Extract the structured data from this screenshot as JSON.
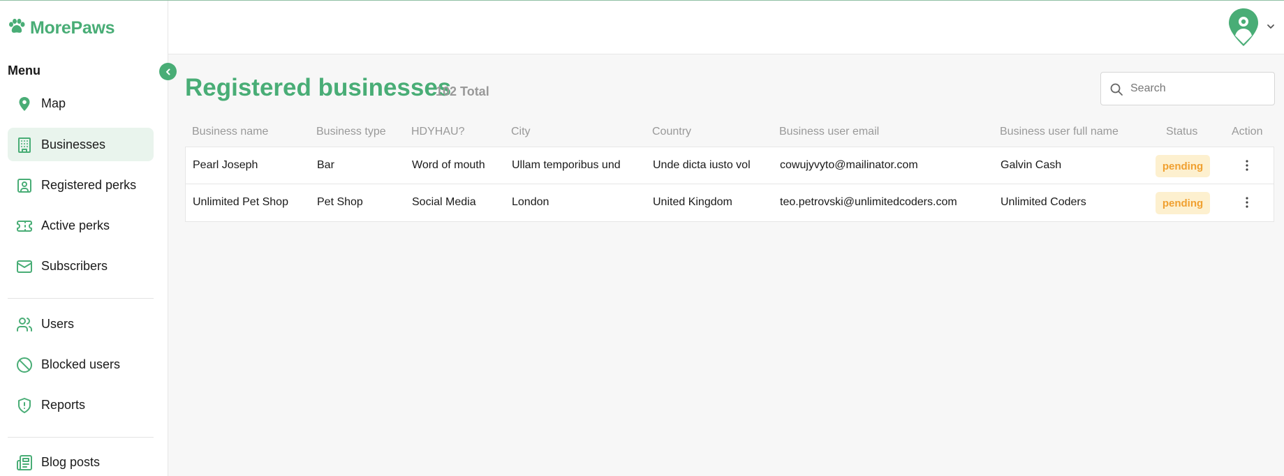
{
  "brand": {
    "name": "MorePaws",
    "color": "#49ad76"
  },
  "sidebar": {
    "menu_label": "Menu",
    "items": [
      {
        "label": "Map",
        "icon": "map-pin-icon",
        "active": false
      },
      {
        "label": "Businesses",
        "icon": "building-icon",
        "active": true
      },
      {
        "label": "Registered perks",
        "icon": "user-square-icon",
        "active": false
      },
      {
        "label": "Active perks",
        "icon": "ticket-icon",
        "active": false
      },
      {
        "label": "Subscribers",
        "icon": "mail-icon",
        "active": false
      },
      {
        "label": "Users",
        "icon": "users-icon",
        "active": false
      },
      {
        "label": "Blocked users",
        "icon": "ban-icon",
        "active": false
      },
      {
        "label": "Reports",
        "icon": "shield-alert-icon",
        "active": false
      },
      {
        "label": "Blog posts",
        "icon": "newspaper-icon",
        "active": false
      }
    ]
  },
  "page": {
    "title": "Registered businesses",
    "total": "102 Total",
    "search_placeholder": "Search"
  },
  "table": {
    "columns": [
      "Business name",
      "Business type",
      "HDYHAU?",
      "City",
      "Country",
      "Business user email",
      "Business user full name",
      "Status",
      "Action"
    ],
    "rows": [
      [
        "Pearl Joseph",
        "Bar",
        "Word of mouth",
        "Ullam temporibus und",
        "Unde dicta iusto vol",
        "cowujyvyto@mailinator.com",
        "Galvin Cash",
        "pending"
      ],
      [
        "Unlimited Pet Shop",
        "Pet Shop",
        "Social Media",
        "London",
        "United Kingdom",
        "teo.petrovski@unlimitedcoders.com",
        "Unlimited Coders",
        "pending"
      ]
    ]
  },
  "colors": {
    "accent": "#49ad76",
    "pending_bg": "#fdf0cf",
    "pending_text": "#f0a030"
  }
}
